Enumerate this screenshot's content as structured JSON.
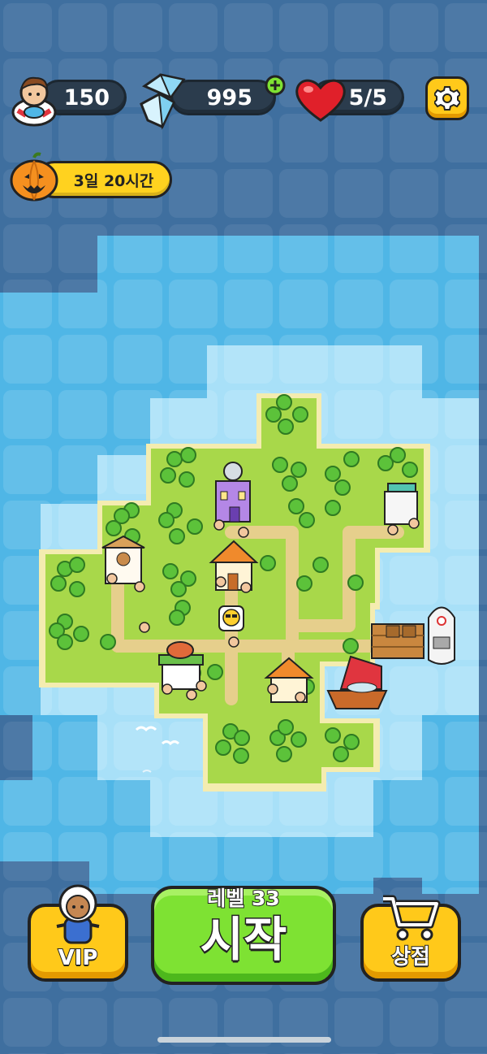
{
  "hud": {
    "coins": {
      "value": "150",
      "icon": "character-lifebuoy-icon"
    },
    "gems": {
      "value": "995",
      "icon": "crystal-gem-icon",
      "add_icon": "plus-icon"
    },
    "lives": {
      "value": "5/5",
      "icon": "heart-icon"
    },
    "settings": {
      "icon": "gear-icon"
    }
  },
  "event": {
    "timer": "3일 20시간",
    "icon": "pumpkin-icon"
  },
  "map": {
    "buildings": [
      "disco-building",
      "cafe-building",
      "house-building",
      "fruit-shop",
      "barn-building",
      "market-stall",
      "dock",
      "sail-boat",
      "motor-boat"
    ],
    "emoji_bubble": "sunglasses-emoji-icon"
  },
  "bottom": {
    "vip": {
      "label": "VIP",
      "icon": "vip-captain-icon"
    },
    "start": {
      "level_label": "레벨 33",
      "label": "시작"
    },
    "shop": {
      "label": "상점",
      "icon": "shopping-cart-icon"
    }
  },
  "colors": {
    "deep_water": "#3f6f9f",
    "water": "#4fb6e6",
    "shallow": "#bfe8fb",
    "grass": "#a8d84a",
    "sand": "#f1e7a4",
    "start_green": "#7ee233",
    "gold": "#ffc91a"
  }
}
